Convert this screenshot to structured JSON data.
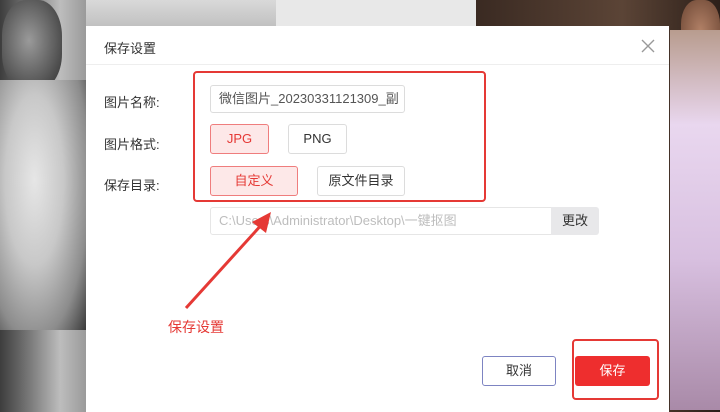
{
  "dialog": {
    "title": "保存设置",
    "name_label": "图片名称:",
    "name_value": "微信图片_20230331121309_副",
    "format_label": "图片格式:",
    "formats": [
      {
        "label": "JPG",
        "selected": true
      },
      {
        "label": "PNG",
        "selected": false
      }
    ],
    "dir_label": "保存目录:",
    "dir_options": [
      {
        "label": "自定义",
        "selected": true
      },
      {
        "label": "原文件目录",
        "selected": false
      }
    ],
    "path_value": "C:\\Users\\Administrator\\Desktop\\一键抠图",
    "change_label": "更改",
    "cancel_label": "取消",
    "save_label": "保存"
  },
  "annotation": {
    "text": "保存设置",
    "color": "#e53935"
  },
  "colors": {
    "accent": "#ee2e2e",
    "selected_border": "#ef7d7d",
    "selected_bg": "#fde8e8"
  },
  "icons": {
    "close": "close-icon",
    "arrow": "arrow-icon"
  }
}
